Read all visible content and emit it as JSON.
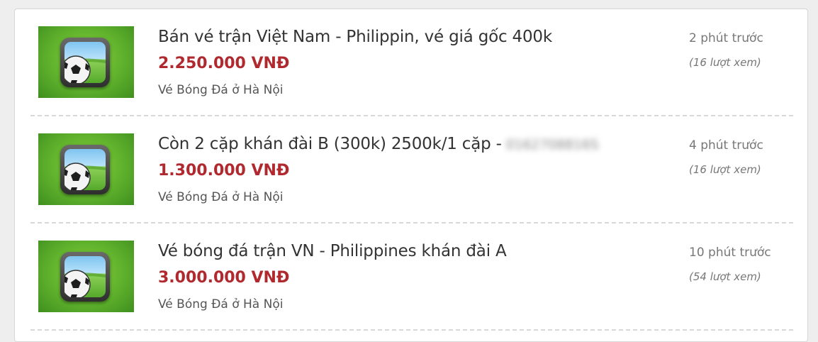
{
  "listings": [
    {
      "title": "Bán vé trận Việt Nam - Philippin, vé giá gốc 400k",
      "title_blurred": "",
      "price": "2.250.000 VNĐ",
      "category": "Vé Bóng Đá ở Hà Nội",
      "time": "2 phút trước",
      "views": "(16 lượt xem)",
      "thumbnail_icon": "soccer-ball-icon"
    },
    {
      "title": "Còn 2 cặp khán đài B (300k) 2500k/1 cặp -",
      "title_blurred": "0162708816S",
      "price": "1.300.000 VNĐ",
      "category": "Vé Bóng Đá ở Hà Nội",
      "time": "4 phút trước",
      "views": "(16 lượt xem)",
      "thumbnail_icon": "soccer-ball-icon"
    },
    {
      "title": "Vé bóng đá trận VN - Philippines khán đài A",
      "title_blurred": "",
      "price": "3.000.000 VNĐ",
      "category": "Vé Bóng Đá ở Hà Nội",
      "time": "10 phút trước",
      "views": "(54 lượt xem)",
      "thumbnail_icon": "soccer-ball-icon"
    }
  ],
  "colors": {
    "price": "#b0292e",
    "thumbnail_green": "#5fb12c",
    "divider": "#d8d8d8"
  }
}
